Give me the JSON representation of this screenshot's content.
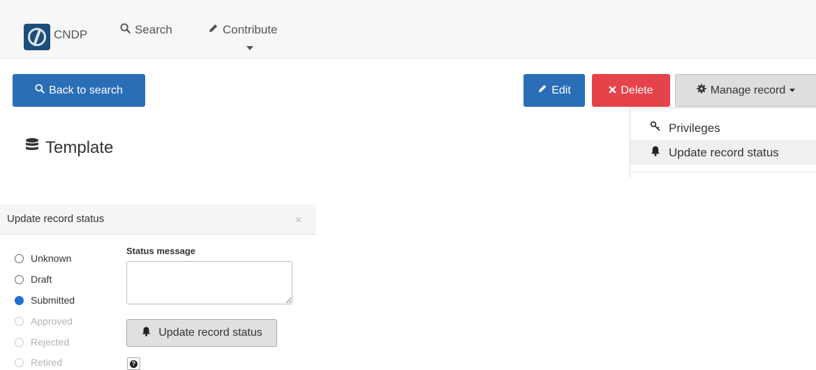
{
  "navbar": {
    "brand": "CNDP",
    "search_label": "Search",
    "contribute_label": "Contribute"
  },
  "toolbar": {
    "back_label": "Back to search",
    "edit_label": "Edit",
    "delete_label": "Delete",
    "manage_label": "Manage record"
  },
  "dropdown": {
    "items": [
      {
        "label": "Privileges",
        "icon": "key-icon"
      },
      {
        "label": "Update record status",
        "icon": "bell-icon"
      }
    ]
  },
  "page": {
    "title": "Template",
    "title_icon": "database-icon"
  },
  "modal": {
    "title": "Update record status",
    "close": "×",
    "status_options": [
      {
        "label": "Unknown",
        "checked": false,
        "disabled": false
      },
      {
        "label": "Draft",
        "checked": false,
        "disabled": false
      },
      {
        "label": "Submitted",
        "checked": true,
        "disabled": false
      },
      {
        "label": "Approved",
        "checked": false,
        "disabled": true
      },
      {
        "label": "Rejected",
        "checked": false,
        "disabled": true
      },
      {
        "label": "Retired",
        "checked": false,
        "disabled": true
      }
    ],
    "status_message_label": "Status message",
    "status_message_value": "",
    "update_button_label": "Update record status",
    "help_glyph": "?"
  },
  "colors": {
    "primary": "#2a6eb8",
    "danger": "#e5434a",
    "radio_checked": "#1f6fd6"
  }
}
